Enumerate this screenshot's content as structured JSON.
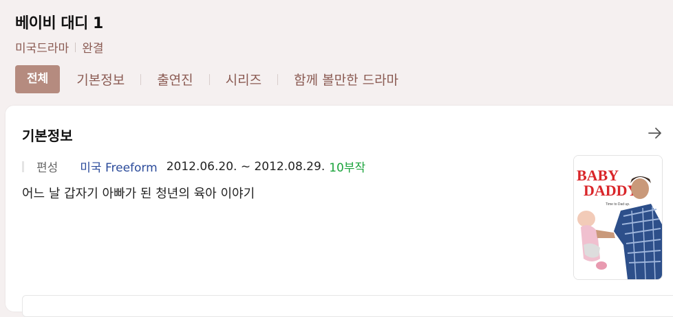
{
  "header": {
    "title": "베이비 대디 1",
    "meta": [
      "미국드라마",
      "완결"
    ],
    "tabs": [
      {
        "label": "전체",
        "active": true
      },
      {
        "label": "기본정보",
        "active": false
      },
      {
        "label": "출연진",
        "active": false
      },
      {
        "label": "시리즈",
        "active": false
      },
      {
        "label": "함께 볼만한 드라마",
        "active": false
      }
    ]
  },
  "basic_info": {
    "title": "기본정보",
    "arrow_icon": "arrow-right-icon",
    "broadcast_label": "편성",
    "channel": "미국 Freeform",
    "dates": "2012.06.20. ~ 2012.08.29.",
    "episodes": "10부작",
    "description": "어느 날 갑자기 아빠가 된 청년의 육아 이야기",
    "poster": {
      "title_line1": "BABY",
      "title_line2": "DADDY",
      "tagline": "Time to Dad up."
    }
  },
  "colors": {
    "accent": "#b58b7f",
    "brand_text": "#8a5a52",
    "channel": "#2a4a9a",
    "episodes": "#1aa33b",
    "background": "#f5f0f0"
  }
}
